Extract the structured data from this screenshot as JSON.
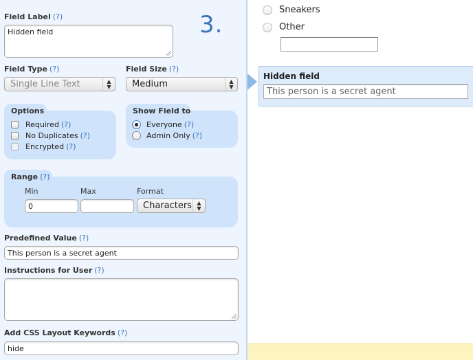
{
  "step_number": "3.",
  "help_text": "(?)",
  "field_label": {
    "label": "Field Label",
    "value": "Hidden field"
  },
  "field_type": {
    "label": "Field Type",
    "selected": "Single Line Text",
    "disabled": true
  },
  "field_size": {
    "label": "Field Size",
    "selected": "Medium"
  },
  "options": {
    "title": "Options",
    "items": [
      {
        "label": "Required",
        "checked": false,
        "disabled": false
      },
      {
        "label": "No Duplicates",
        "checked": false,
        "disabled": false
      },
      {
        "label": "Encrypted",
        "checked": false,
        "disabled": true
      }
    ]
  },
  "show_field_to": {
    "title": "Show Field to",
    "items": [
      {
        "label": "Everyone",
        "selected": true
      },
      {
        "label": "Admin Only",
        "selected": false
      }
    ]
  },
  "range": {
    "title": "Range",
    "min_label": "Min",
    "max_label": "Max",
    "format_label": "Format",
    "min_value": "0",
    "max_value": "",
    "format_selected": "Characters"
  },
  "predefined_value": {
    "label": "Predefined Value",
    "value": "This person is a secret agent"
  },
  "instructions": {
    "label": "Instructions for User",
    "value": ""
  },
  "css_keywords": {
    "label": "Add CSS Layout Keywords",
    "value": "hide"
  },
  "preview": {
    "radio_options": [
      {
        "label": "Sneakers"
      },
      {
        "label": "Other"
      }
    ],
    "other_input_value": "",
    "selected_field": {
      "title": "Hidden field",
      "value": "This person is a secret agent"
    }
  },
  "colors": {
    "accent": "#3b73b9",
    "panel_bg": "#eef5fe",
    "group_bg": "#cfe3fb",
    "selected_bg": "#ddebfb",
    "footer_bg": "#fdf4c0"
  }
}
